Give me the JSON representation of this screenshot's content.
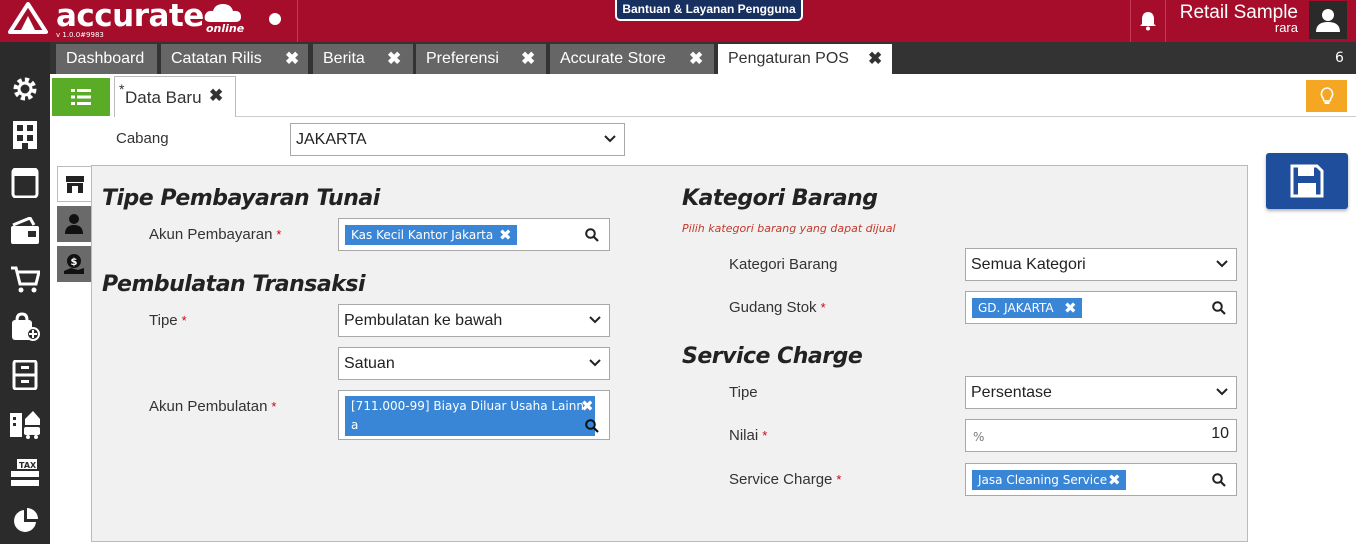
{
  "header": {
    "brand": "accurate",
    "brand_suffix": "online",
    "version": "v 1.0.0#9983",
    "help_label": "Bantuan & Layanan Pengguna",
    "user_name": "Retail Sample",
    "user_sub": "rara"
  },
  "tabs": [
    {
      "label": "Dashboard"
    },
    {
      "label": "Catatan Rilis"
    },
    {
      "label": "Berita"
    },
    {
      "label": "Preferensi"
    },
    {
      "label": "Accurate Store"
    },
    {
      "label": "Pengaturan POS"
    }
  ],
  "tab_count": "6",
  "subtab": {
    "star": "*",
    "label": "Data Baru"
  },
  "branch": {
    "label": "Cabang",
    "value": "JAKARTA"
  },
  "cash_payment": {
    "title": "Tipe Pembayaran Tunai",
    "account_label": "Akun Pembayaran",
    "account_value": "Kas Kecil Kantor Jakarta"
  },
  "rounding": {
    "title": "Pembulatan Transaksi",
    "type_label": "Tipe",
    "type_value": "Pembulatan ke bawah",
    "unit_value": "Satuan",
    "account_label": "Akun Pembulatan",
    "account_value": "[711.000-99] Biaya Diluar Usaha Lainn",
    "account_value_cont": "a"
  },
  "category": {
    "title": "Kategori Barang",
    "hint": "Pilih kategori barang yang dapat dijual",
    "category_label": "Kategori Barang",
    "category_value": "Semua Kategori",
    "warehouse_label": "Gudang Stok",
    "warehouse_value": "GD. JAKARTA"
  },
  "service_charge": {
    "title": "Service Charge",
    "type_label": "Tipe",
    "type_value": "Persentase",
    "value_label": "Nilai",
    "value_unit": "%",
    "value": "10",
    "charge_label": "Service Charge",
    "charge_value": "Jasa Cleaning Service"
  },
  "required_marker": "*",
  "colors": {
    "brand_red": "#a50d2b",
    "sidebar": "#2b2b2b",
    "green": "#5aac26",
    "tag_blue": "#3a86d6",
    "save_blue": "#1f4e9c",
    "orange": "#f5a623"
  }
}
